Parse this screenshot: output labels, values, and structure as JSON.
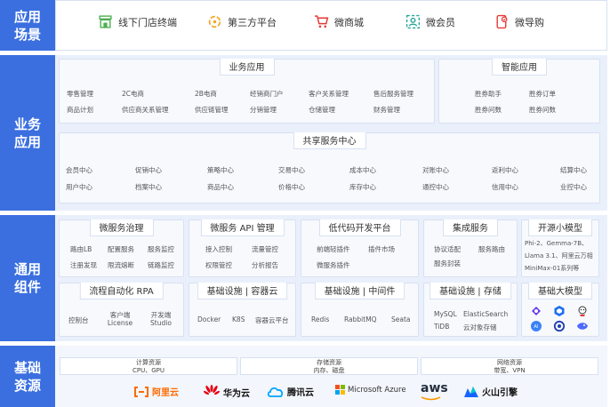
{
  "layers": {
    "scenarios": "应用\n场景",
    "business": "业务\n应用",
    "common": "通用\n组件",
    "infra": "基础\n资源"
  },
  "scenarios": [
    {
      "label": "线下门店终端",
      "icon": "store-icon",
      "color": "#4caf50"
    },
    {
      "label": "第三方平台",
      "icon": "third-party-icon",
      "color": "#f5a623"
    },
    {
      "label": "微商城",
      "icon": "cart-icon",
      "color": "#e53935"
    },
    {
      "label": "微会员",
      "icon": "member-icon",
      "color": "#26a69a"
    },
    {
      "label": "微导购",
      "icon": "guide-icon",
      "color": "#e53935"
    }
  ],
  "business_app": {
    "title": "业务应用",
    "items": [
      "零售管理",
      "2C电商",
      "2B电商",
      "经销商门户",
      "客户关系管理",
      "售后服务管理",
      "商品计划",
      "供应商关系管理",
      "供应链管理",
      "分销管理",
      "仓储管理",
      "财务管理"
    ]
  },
  "smart_app": {
    "title": "智能应用",
    "items": [
      "胜券助手",
      "胜券订单",
      "胜券问数",
      "胜券问数"
    ]
  },
  "shared_services": {
    "title": "共享服务中心",
    "items": [
      "会员中心",
      "促销中心",
      "策略中心",
      "交易中心",
      "成本中心",
      "对账中心",
      "返利中心",
      "结算中心",
      "用户中心",
      "档案中心",
      "商品中心",
      "价格中心",
      "库存中心",
      "通控中心",
      "信用中心",
      "业控中心"
    ]
  },
  "components": [
    {
      "title": "微服务治理",
      "items": [
        "路由LB",
        "配置服务",
        "服务监控",
        "注册发现",
        "限流熔断",
        "链路监控"
      ]
    },
    {
      "title": "微服务 API 管理",
      "items": [
        "接入控制",
        "流量管控",
        "权限管控",
        "分析报告"
      ]
    },
    {
      "title": "低代码开发平台",
      "items": [
        "前端轻插件",
        "插件市场",
        "微服务插件"
      ]
    },
    {
      "title": "集成服务",
      "items": [
        "协议适配",
        "服务路由",
        "服务封装"
      ]
    },
    {
      "title": "开源小模型",
      "items": [
        "Phi-2、Gemma-7B、",
        "Llama 3.1、阿里云万相",
        "MiniMax-01系列等"
      ]
    },
    {
      "title": "流程自动化 RPA",
      "items": [
        "控制台",
        "客户端 License",
        "开发端 Studio"
      ]
    },
    {
      "title": "基础设施 | 容器云",
      "items": [
        "Docker",
        "K8S",
        "容器云平台"
      ]
    },
    {
      "title": "基础设施 | 中间件",
      "items": [
        "Redis",
        "RabbitMQ",
        "Seata"
      ]
    },
    {
      "title": "基础设施 | 存储",
      "items": [
        "MySQL",
        "ElasticSearch",
        "TiDB",
        "云对象存储"
      ]
    },
    {
      "title": "基础大模型",
      "items": []
    }
  ],
  "resources": [
    {
      "line1": "计算资源",
      "line2": "CPU、GPU"
    },
    {
      "line1": "存储资源",
      "line2": "内存、磁盘"
    },
    {
      "line1": "网络资源",
      "line2": "带宽、VPN"
    }
  ],
  "vendors": [
    {
      "label": "阿里云",
      "icon": "aliyun-logo",
      "color": "#ff6a00"
    },
    {
      "label": "华为云",
      "icon": "huawei-logo",
      "color": "#111111"
    },
    {
      "label": "腾讯云",
      "icon": "tencent-cloud-logo",
      "color": "#111111"
    },
    {
      "label": "Microsoft Azure",
      "icon": "microsoft-logo",
      "color": "#111111"
    },
    {
      "label": "aws",
      "icon": "aws-logo",
      "color": "#111111"
    },
    {
      "label": "火山引擎",
      "icon": "volcano-engine-logo",
      "color": "#111111"
    }
  ]
}
